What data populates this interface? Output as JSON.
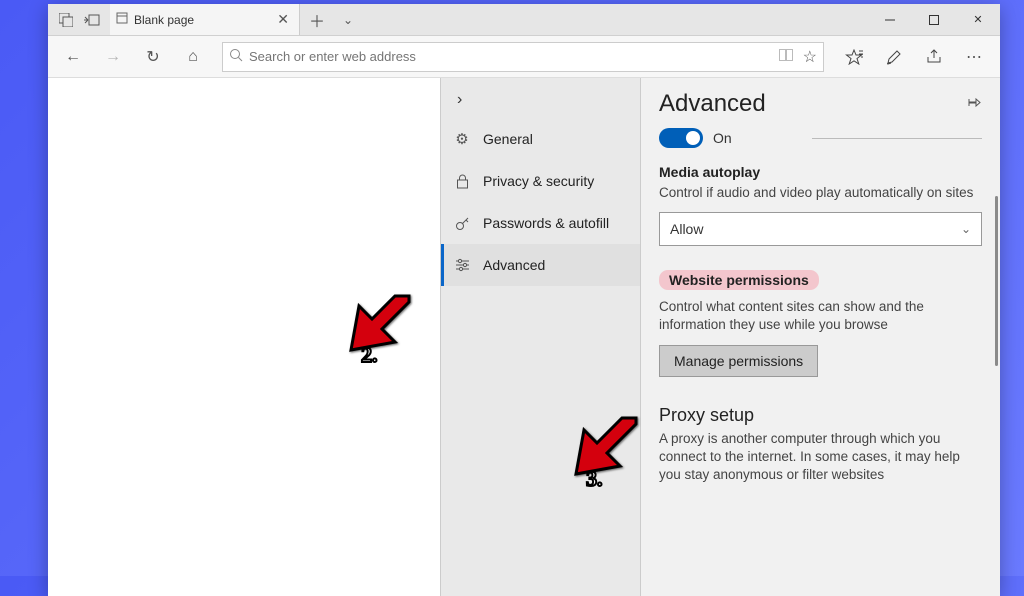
{
  "titlebar": {
    "tab_title": "Blank page"
  },
  "navbar": {
    "placeholder": "Search or enter web address"
  },
  "settings": {
    "sidebar": {
      "items": [
        {
          "label": "General"
        },
        {
          "label": "Privacy & security"
        },
        {
          "label": "Passwords & autofill"
        },
        {
          "label": "Advanced"
        }
      ]
    },
    "pane": {
      "title": "Advanced",
      "toggle_label": "On",
      "media_heading": "Media autoplay",
      "media_desc": "Control if audio and video play automatically on sites",
      "media_value": "Allow",
      "perm_heading": "Website permissions",
      "perm_desc": "Control what content sites can show and the information they use while you browse",
      "perm_button": "Manage permissions",
      "proxy_heading": "Proxy setup",
      "proxy_desc": "A proxy is another computer through which you connect to the internet. In some cases, it may help you stay anonymous or filter websites"
    }
  },
  "annotations": {
    "n2": "2.",
    "n3": "3."
  }
}
